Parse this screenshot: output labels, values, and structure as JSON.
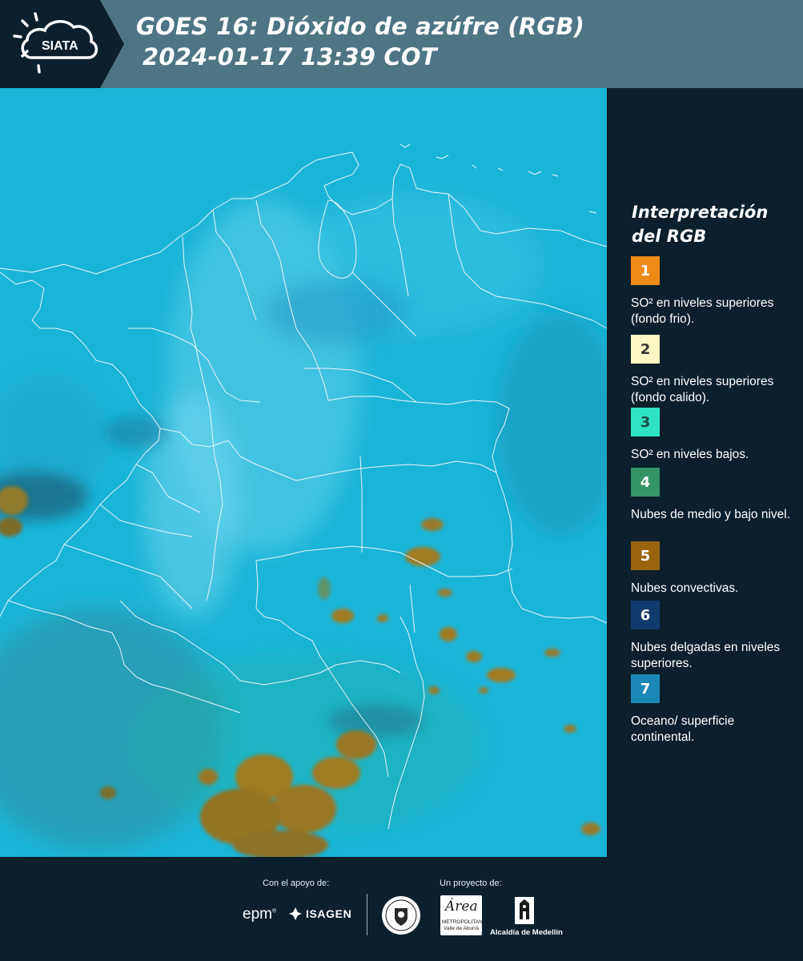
{
  "header": {
    "logo_text": "SIATA",
    "title_line1": "GOES 16: Dióxido de azúfre (RGB)",
    "title_line2": "2024-01-17 13:39 COT"
  },
  "legend": {
    "title_line1": "Interpretación",
    "title_line2": "del RGB",
    "items": [
      {
        "number": "1",
        "color": "#f08a17",
        "text_color": "#ffffff",
        "label": "SO² en niveles superiores (fondo frio)."
      },
      {
        "number": "2",
        "color": "#fdf7c6",
        "text_color": "#333333",
        "label": "SO² en niveles superiores (fondo calido)."
      },
      {
        "number": "3",
        "color": "#2fe3c5",
        "text_color": "#1b4e49",
        "label": "SO² en niveles bajos."
      },
      {
        "number": "4",
        "color": "#339466",
        "text_color": "#ffffff",
        "label": "Nubes de medio y bajo nivel."
      },
      {
        "number": "5",
        "color": "#99640e",
        "text_color": "#ffffff",
        "label": "Nubes convectivas."
      },
      {
        "number": "6",
        "color": "#113b6d",
        "text_color": "#ffffff",
        "label": "Nubes delgadas en niveles superiores."
      },
      {
        "number": "7",
        "color": "#1c88b8",
        "text_color": "#ffffff",
        "label": "Oceano/ superficie continental."
      }
    ]
  },
  "footer": {
    "support_label": "Con el apoyo de:",
    "project_label": "Un proyecto de:",
    "epm": "epm",
    "isagen": "ISAGEN",
    "area_word": "Área",
    "area_sub": "METROPOLITANA Valle de Aburrá",
    "alcaldia": "Alcaldía de Medellín"
  },
  "colors": {
    "map_base": "#1bb4d9",
    "header_bg": "#4d7583",
    "logo_bg": "#0c1f2c",
    "panel_bg": "#0c1f2c"
  },
  "icons": [
    "siata-sun-cloud-icon",
    "isagen-icon",
    "medellin-seal-icon",
    "alcaldia-building-icon"
  ]
}
